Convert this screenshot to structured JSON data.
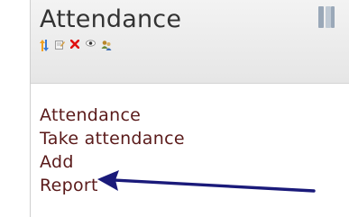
{
  "block": {
    "title": "Attendance",
    "icons": [
      "move-icon",
      "edit-icon",
      "delete-icon",
      "hide-icon",
      "assign-roles-icon"
    ],
    "links": [
      "Attendance",
      "Take attendance",
      "Add",
      "Report"
    ]
  },
  "colors": {
    "link": "#5a1a1a",
    "title": "#333333",
    "header_bg": "#ececec",
    "arrow": "#1a1a7a"
  }
}
